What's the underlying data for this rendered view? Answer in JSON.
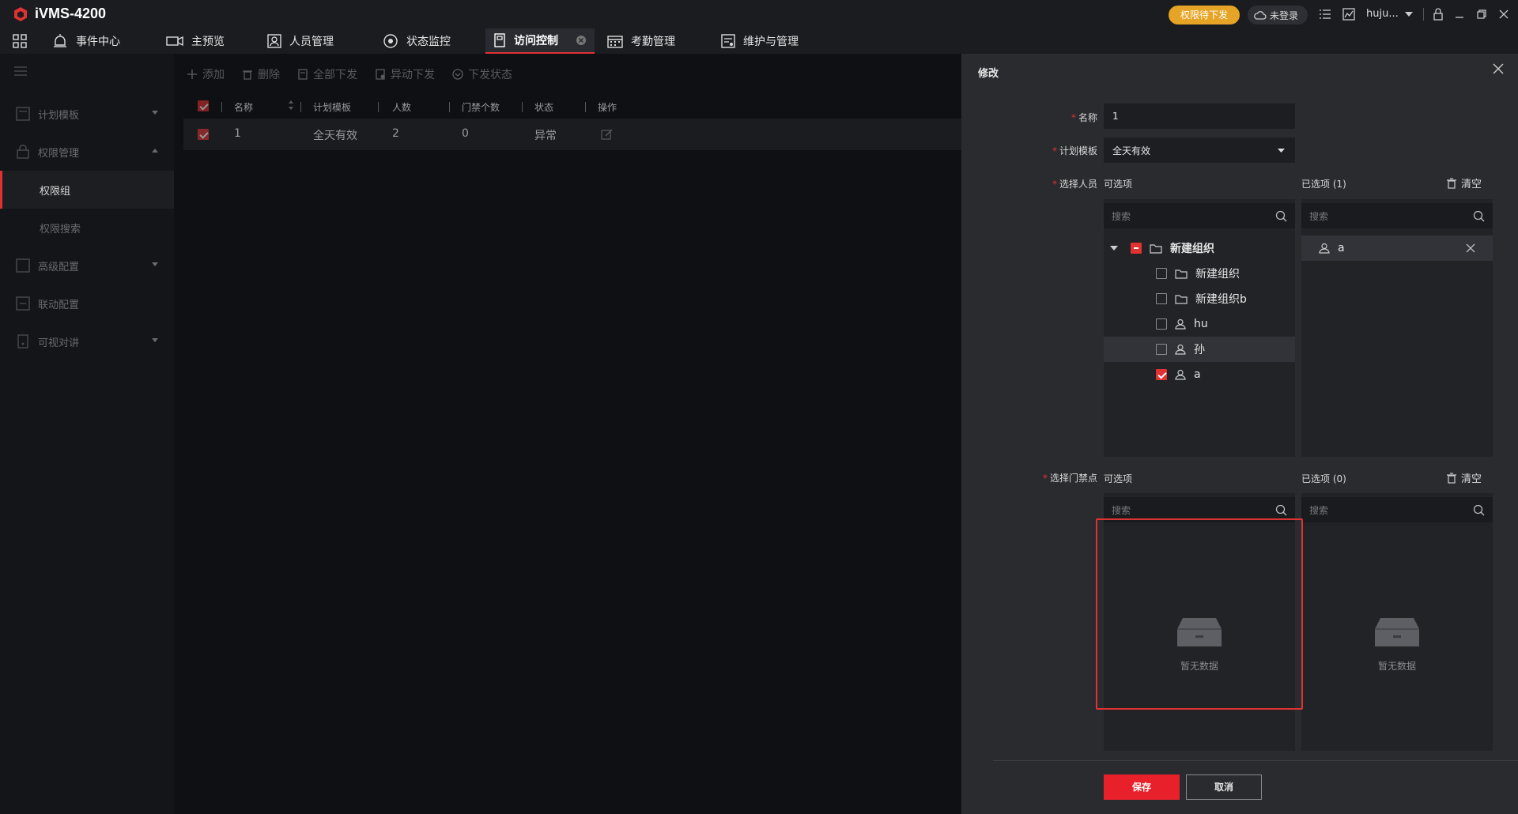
{
  "app": {
    "title": "iVMS-4200",
    "perm_pending": "权限待下发",
    "login_status": "未登录",
    "username": "huju..."
  },
  "nav": {
    "items": [
      {
        "label": "事件中心",
        "icon": "bell-icon"
      },
      {
        "label": "主预览",
        "icon": "camera-icon"
      },
      {
        "label": "人员管理",
        "icon": "person-card-icon"
      },
      {
        "label": "状态监控",
        "icon": "monitor-icon"
      },
      {
        "label": "访问控制",
        "icon": "door-icon"
      },
      {
        "label": "考勤管理",
        "icon": "calendar-icon"
      },
      {
        "label": "维护与管理",
        "icon": "maintenance-icon"
      }
    ],
    "active": "访问控制"
  },
  "sidebar": {
    "items": [
      {
        "label": "计划模板"
      },
      {
        "label": "权限管理"
      },
      {
        "label": "权限组"
      },
      {
        "label": "权限搜索"
      },
      {
        "label": "高级配置"
      },
      {
        "label": "联动配置"
      },
      {
        "label": "可视对讲"
      }
    ]
  },
  "toolbar": {
    "add": "添加",
    "delete": "删除",
    "apply_all": "全部下发",
    "apply_changed": "异动下发",
    "apply_status": "下发状态"
  },
  "table": {
    "columns": [
      "名称",
      "计划模板",
      "人数",
      "门禁个数",
      "状态",
      "操作"
    ],
    "rows": [
      {
        "name": "1",
        "template": "全天有效",
        "people": "2",
        "doors": "0",
        "status": "异常"
      }
    ]
  },
  "modal": {
    "title": "修改",
    "name_label": "名称",
    "name_value": "1",
    "template_label": "计划模板",
    "template_value": "全天有效",
    "person_label": "选择人员",
    "available": "可选项",
    "selected_people": "已选项 (1)",
    "clear": "清空",
    "search_placeholder": "搜索",
    "tree": [
      {
        "label": "新建组织"
      },
      {
        "label": "新建组织"
      },
      {
        "label": "新建组织b"
      },
      {
        "label": "hu"
      },
      {
        "label": "孙"
      },
      {
        "label": "a"
      }
    ],
    "selected_person": "a",
    "door_label": "选择门禁点",
    "selected_doors": "已选项 (0)",
    "empty_text": "暂无数据",
    "save": "保存",
    "cancel": "取消"
  },
  "colors": {
    "accent": "#e03232",
    "pending": "#e5a425"
  }
}
